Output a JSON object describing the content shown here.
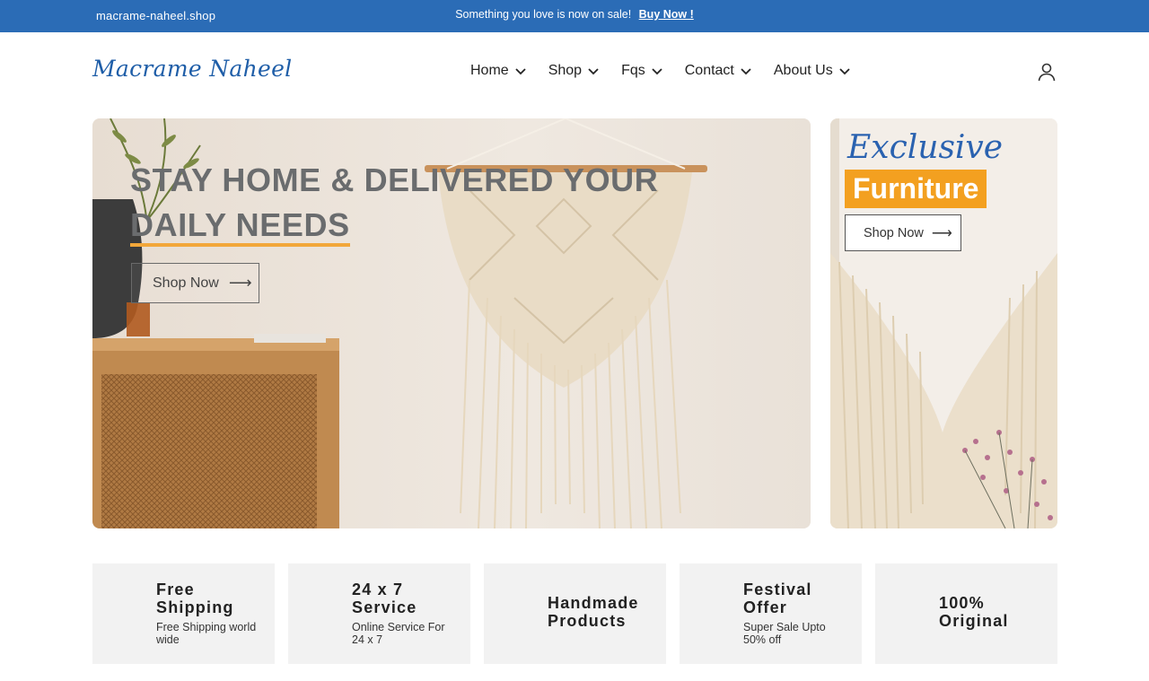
{
  "topbar": {
    "domain": "macrame-naheel.shop",
    "promo_text": "Something you love is now on sale!",
    "promo_link": "Buy Now !",
    "background": "#2b6cb6"
  },
  "header": {
    "logo": "Macrame Naheel",
    "nav": [
      {
        "label": "Home"
      },
      {
        "label": "Shop"
      },
      {
        "label": "Fqs"
      },
      {
        "label": "Contact"
      },
      {
        "label": "About Us"
      }
    ],
    "account_icon": "user-icon"
  },
  "hero": {
    "title_line1": "STAY HOME & DELIVERED YOUR",
    "title_line2": "DAILY NEEDS",
    "button_label": "Shop Now",
    "button_arrow": "⟶",
    "accent": "#f2a73a"
  },
  "side_banner": {
    "script_text": "Exclusive",
    "highlight_text": "Furniture",
    "button_label": "Shop Now",
    "button_arrow": "⟶",
    "accent": "#f3a020"
  },
  "features": [
    {
      "title": "Free Shipping",
      "subtitle": "Free Shipping world wide"
    },
    {
      "title": "24 x 7 Service",
      "subtitle": "Online Service For 24 x 7"
    },
    {
      "title": "Handmade Products",
      "subtitle": ""
    },
    {
      "title": "Festival Offer",
      "subtitle": "Super Sale Upto 50% off"
    },
    {
      "title": "100% Original",
      "subtitle": ""
    }
  ]
}
